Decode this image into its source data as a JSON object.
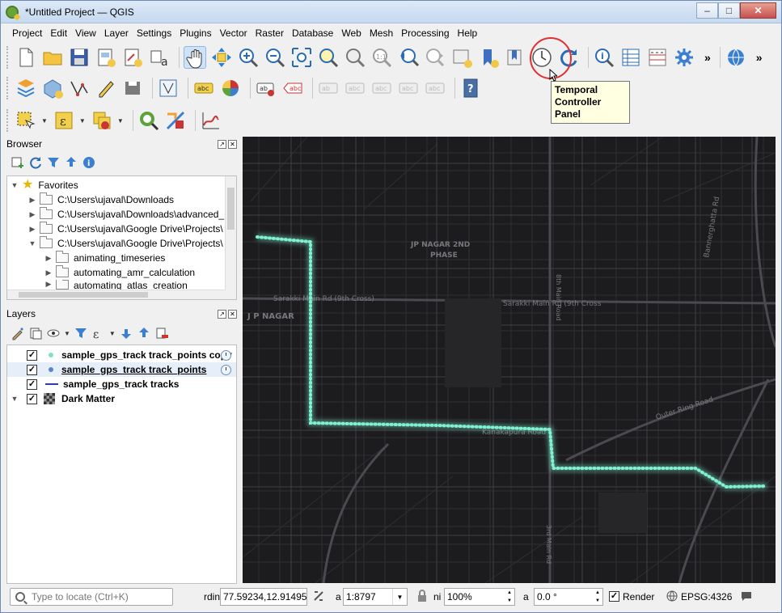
{
  "window": {
    "title": "*Untitled Project — QGIS"
  },
  "menu": [
    "Project",
    "Edit",
    "View",
    "Layer",
    "Settings",
    "Plugins",
    "Vector",
    "Raster",
    "Database",
    "Web",
    "Mesh",
    "Processing",
    "Help"
  ],
  "tooltip": {
    "line1": "Temporal",
    "line2": "Controller Panel"
  },
  "browser": {
    "title": "Browser",
    "favorites_label": "Favorites",
    "items": [
      "C:\\Users\\ujaval\\Downloads",
      "C:\\Users\\ujaval\\Downloads\\advanced_",
      "C:\\Users\\ujaval\\Google Drive\\Projects\\",
      "C:\\Users\\ujaval\\Google Drive\\Projects\\"
    ],
    "subitems": [
      "animating_timeseries",
      "automating_amr_calculation",
      "automating_atlas_creation"
    ]
  },
  "layers": {
    "title": "Layers",
    "items": [
      {
        "name": "sample_gps_track track_points copy",
        "checked": true,
        "style": "bold",
        "symbol": "dot",
        "color": "#7fe0c8",
        "temporal": true
      },
      {
        "name": "sample_gps_track track_points",
        "checked": true,
        "style": "under",
        "symbol": "dot",
        "color": "#5a86c9",
        "temporal": true
      },
      {
        "name": "sample_gps_track tracks",
        "checked": true,
        "style": "bold",
        "symbol": "line",
        "color": "#2a3ea8",
        "temporal": false
      },
      {
        "name": "Dark Matter",
        "checked": true,
        "style": "bold",
        "symbol": "raster",
        "color": "#333333",
        "temporal": false
      }
    ]
  },
  "map": {
    "labels": [
      "JP NAGAR 2ND",
      "PHASE",
      "J P NAGAR",
      "Sarakki Main Rd (9th Cross)",
      "Sarakki Main Rd (9th Cross",
      "Outer Ring Road",
      "Bannerghatta Rd",
      "Kanakapura Road",
      "8th Main Road",
      "3rd Main Rd"
    ],
    "track_color": "#7ff0d0"
  },
  "status": {
    "locate_placeholder": "Type to locate (Ctrl+K)",
    "coordinate_label": "rdin",
    "coordinate": "77.59234,12.91495",
    "scale_label": "a",
    "scale": "1:8797",
    "magnifier_label": "ni",
    "magnifier": "100%",
    "rotation_label": "a",
    "rotation": "0.0 °",
    "render_label": "Render",
    "render_checked": true,
    "crs": "EPSG:4326"
  }
}
